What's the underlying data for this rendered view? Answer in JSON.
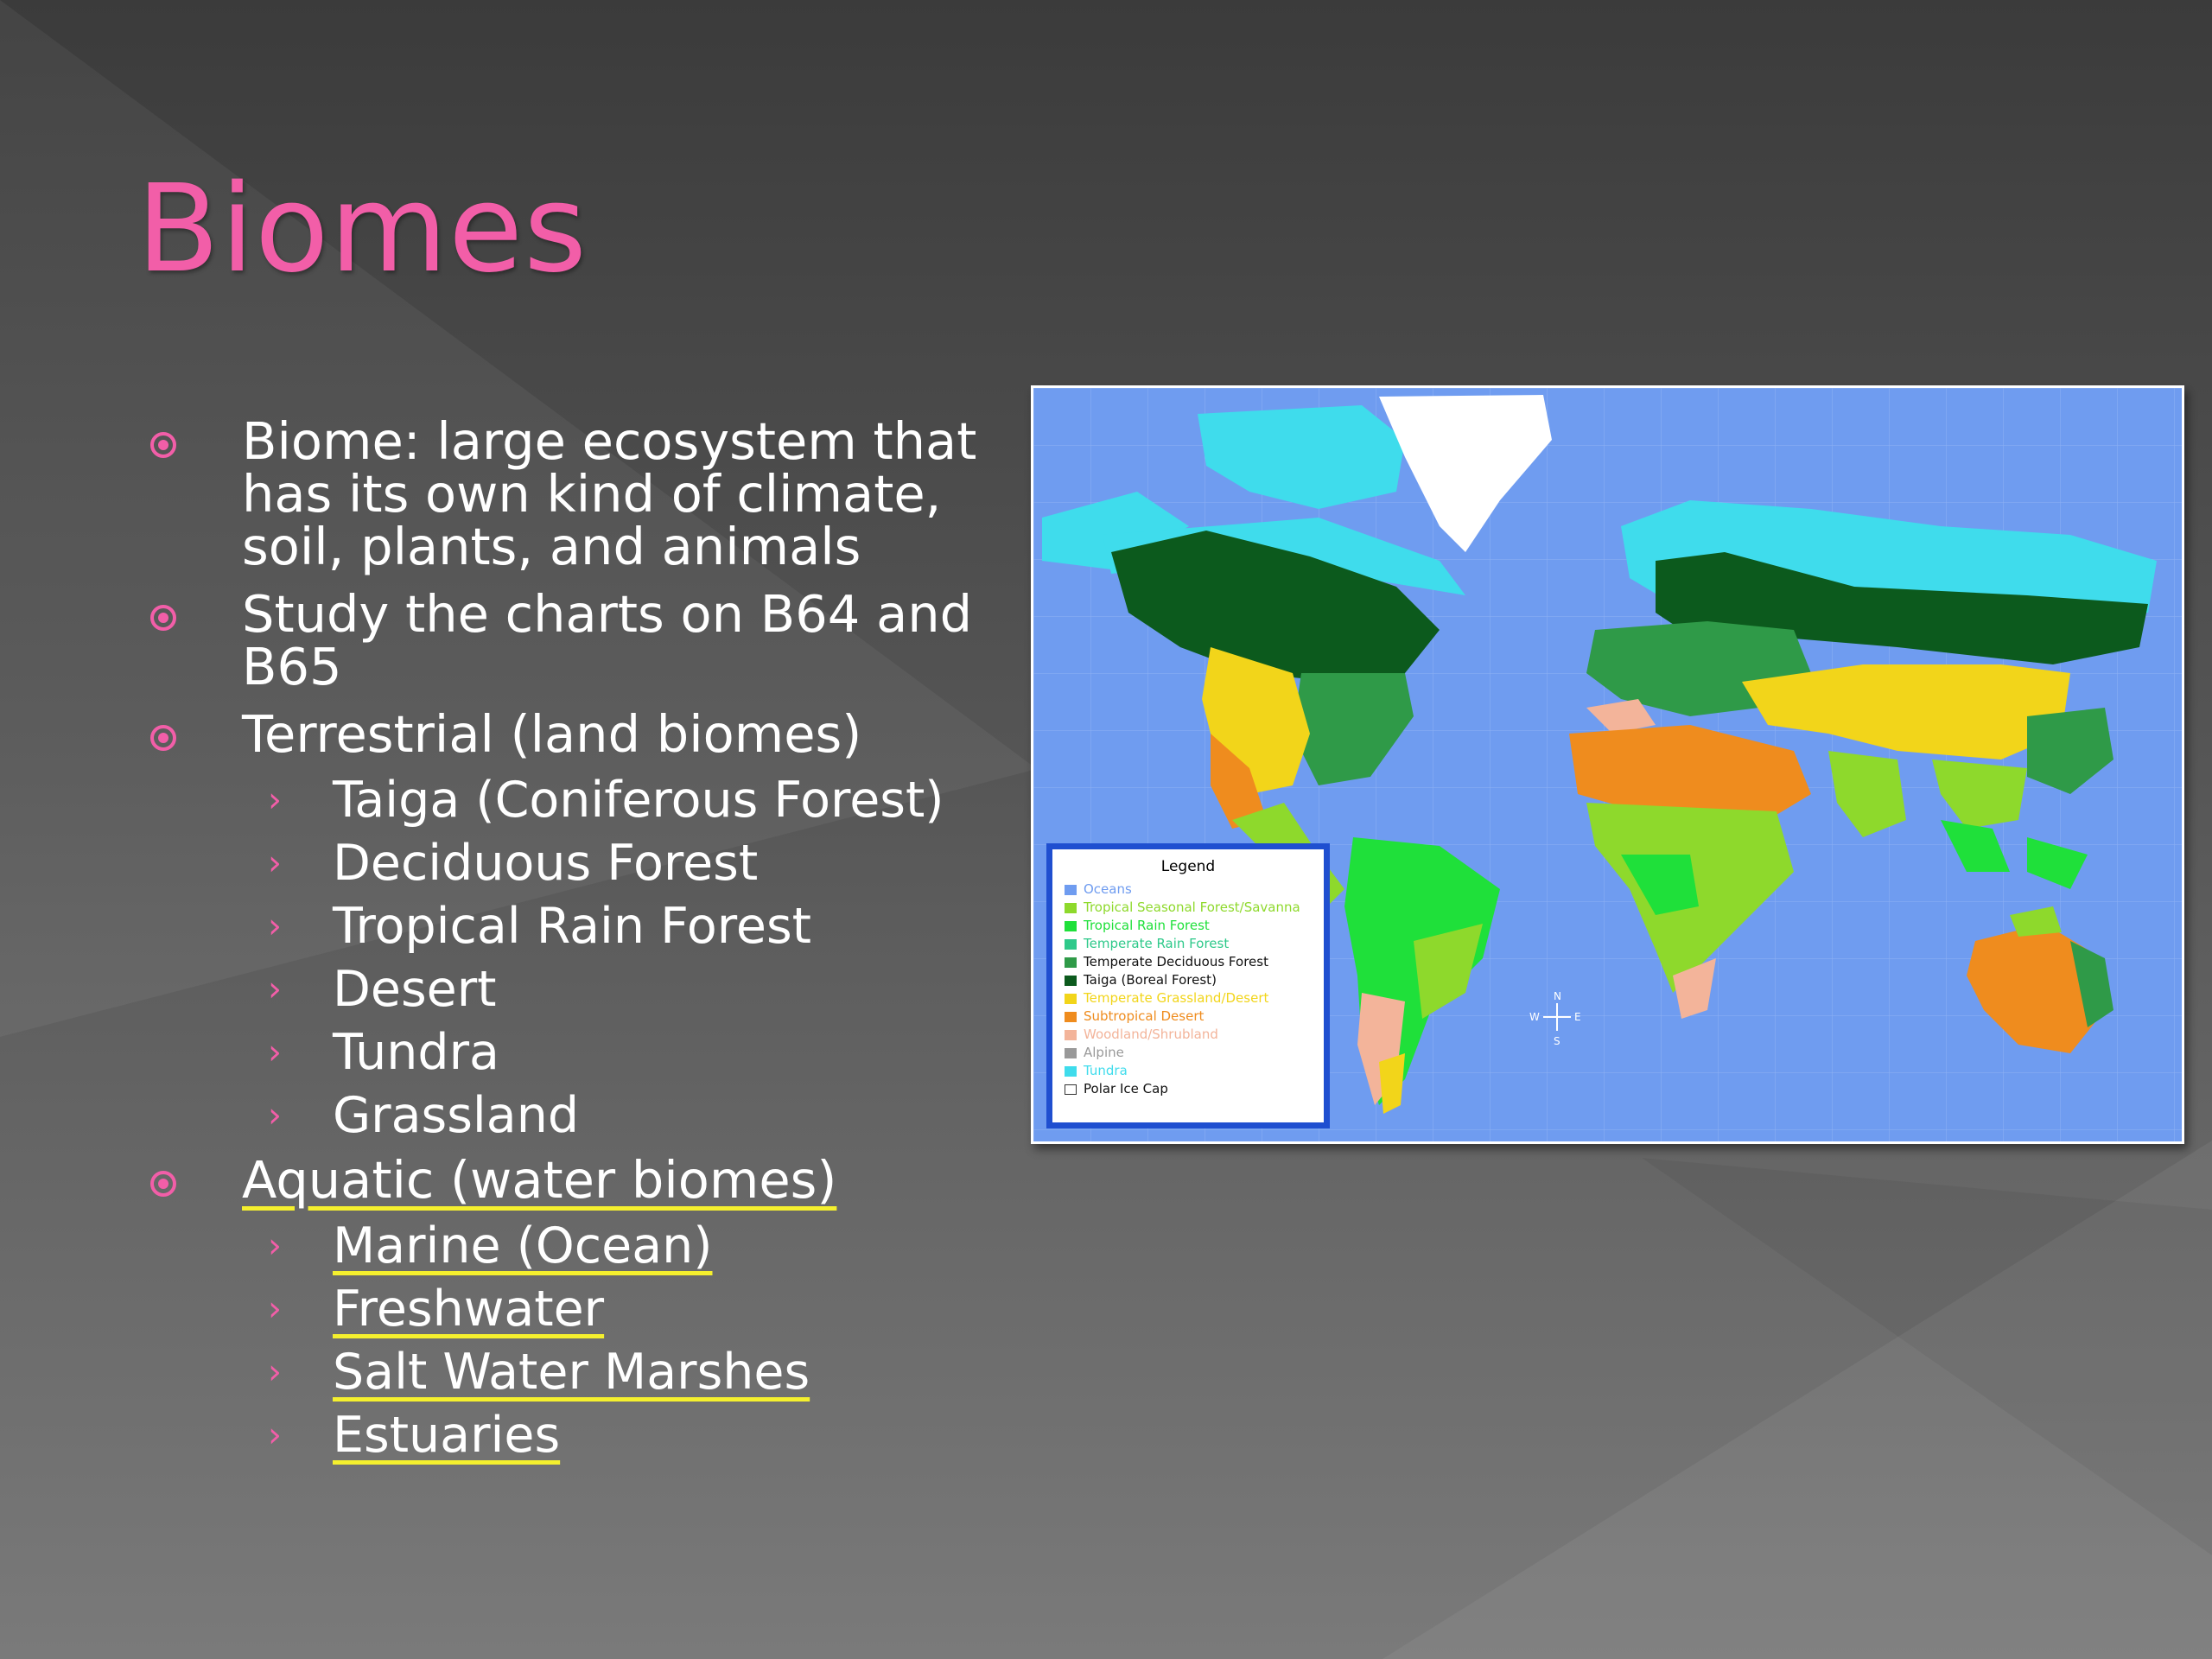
{
  "slide": {
    "title": "Biomes",
    "bullets": [
      {
        "text": "Biome: large ecosystem that has its own kind of climate, soil, plants, and animals"
      },
      {
        "text": "Study the charts on B64 and B65"
      },
      {
        "text": "Terrestrial (land biomes)",
        "subitems": [
          "Taiga (Coniferous Forest)",
          "Deciduous Forest",
          "Tropical Rain Forest",
          "Desert",
          "Tundra",
          "Grassland"
        ]
      },
      {
        "text": "Aquatic (water biomes)",
        "subitems": [
          "Marine (Ocean)",
          "Freshwater",
          "Salt Water Marshes",
          "Estuaries"
        ]
      }
    ]
  },
  "map": {
    "compass": {
      "n": "N",
      "s": "S",
      "e": "E",
      "w": "W"
    },
    "legend": {
      "title": "Legend",
      "items": [
        {
          "label": "Oceans",
          "color": "#6f9cf0"
        },
        {
          "label": "Tropical Seasonal Forest/Savanna",
          "color": "#8ed92c"
        },
        {
          "label": "Tropical Rain Forest",
          "color": "#1fe03a"
        },
        {
          "label": "Temperate Rain Forest",
          "color": "#2ec98a"
        },
        {
          "label": "Temperate Deciduous Forest",
          "color": "#2f9a48"
        },
        {
          "label": "Taiga (Boreal Forest)",
          "color": "#0c5a1d"
        },
        {
          "label": "Temperate Grassland/Desert",
          "color": "#f2d51a"
        },
        {
          "label": "Subtropical Desert",
          "color": "#ef8c1e"
        },
        {
          "label": "Woodland/Shrubland",
          "color": "#f3b49a"
        },
        {
          "label": "Alpine",
          "color": "#999999"
        },
        {
          "label": "Tundra",
          "color": "#3fdcec"
        },
        {
          "label": "Polar Ice Cap",
          "color": "#ffffff"
        }
      ]
    }
  },
  "colors": {
    "accent": "#f25ea8",
    "underline": "#f5f02e",
    "legend_border": "#1f4fd0"
  }
}
